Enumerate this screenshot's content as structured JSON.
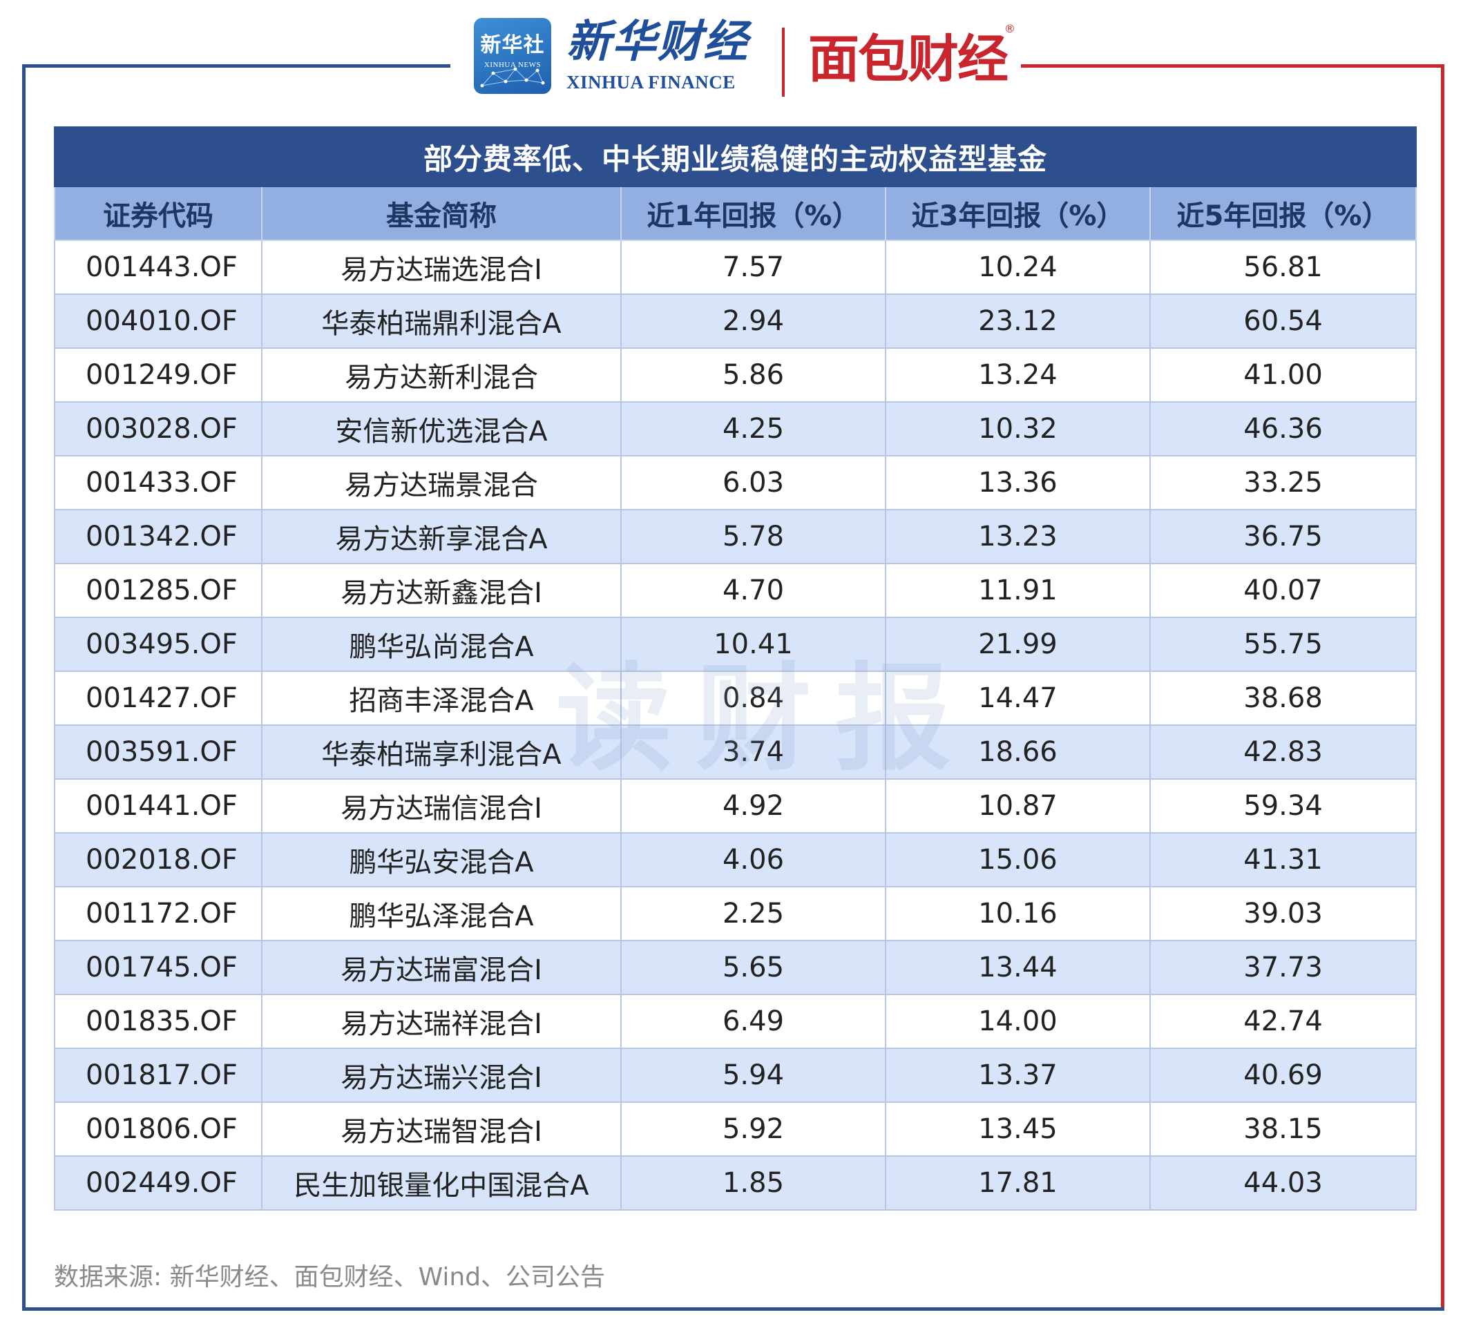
{
  "logos": {
    "xinhuashe_cn": "新华社",
    "xinhuashe_en": "XINHUA NEWS",
    "xinhua_finance_cn": "新华财经",
    "xinhua_finance_en": "XINHUA FINANCE",
    "mianbao_cn": "面包财经",
    "mianbao_reg": "®"
  },
  "table": {
    "title": "部分费率低、中长期业绩稳健的主动权益型基金",
    "headers": [
      "证券代码",
      "基金简称",
      "近1年回报（%）",
      "近3年回报（%）",
      "近5年回报（%）"
    ],
    "rows": [
      [
        "001443.OF",
        "易方达瑞选混合I",
        "7.57",
        "10.24",
        "56.81"
      ],
      [
        "004010.OF",
        "华泰柏瑞鼎利混合A",
        "2.94",
        "23.12",
        "60.54"
      ],
      [
        "001249.OF",
        "易方达新利混合",
        "5.86",
        "13.24",
        "41.00"
      ],
      [
        "003028.OF",
        "安信新优选混合A",
        "4.25",
        "10.32",
        "46.36"
      ],
      [
        "001433.OF",
        "易方达瑞景混合",
        "6.03",
        "13.36",
        "33.25"
      ],
      [
        "001342.OF",
        "易方达新享混合A",
        "5.78",
        "13.23",
        "36.75"
      ],
      [
        "001285.OF",
        "易方达新鑫混合I",
        "4.70",
        "11.91",
        "40.07"
      ],
      [
        "003495.OF",
        "鹏华弘尚混合A",
        "10.41",
        "21.99",
        "55.75"
      ],
      [
        "001427.OF",
        "招商丰泽混合A",
        "0.84",
        "14.47",
        "38.68"
      ],
      [
        "003591.OF",
        "华泰柏瑞享利混合A",
        "3.74",
        "18.66",
        "42.83"
      ],
      [
        "001441.OF",
        "易方达瑞信混合I",
        "4.92",
        "10.87",
        "59.34"
      ],
      [
        "002018.OF",
        "鹏华弘安混合A",
        "4.06",
        "15.06",
        "41.31"
      ],
      [
        "001172.OF",
        "鹏华弘泽混合A",
        "2.25",
        "10.16",
        "39.03"
      ],
      [
        "001745.OF",
        "易方达瑞富混合I",
        "5.65",
        "13.44",
        "37.73"
      ],
      [
        "001835.OF",
        "易方达瑞祥混合I",
        "6.49",
        "14.00",
        "42.74"
      ],
      [
        "001817.OF",
        "易方达瑞兴混合I",
        "5.94",
        "13.37",
        "40.69"
      ],
      [
        "001806.OF",
        "易方达瑞智混合I",
        "5.92",
        "13.45",
        "38.15"
      ],
      [
        "002449.OF",
        "民生加银量化中国混合A",
        "1.85",
        "17.81",
        "44.03"
      ]
    ]
  },
  "watermark": "读财报",
  "source": "数据来源: 新华财经、面包财经、Wind、公司公告",
  "colors": {
    "brand_blue": "#2e4f8e",
    "brand_red": "#c8262c",
    "header_bg": "#93aee0",
    "stripe_bg": "#d8e4fa"
  }
}
